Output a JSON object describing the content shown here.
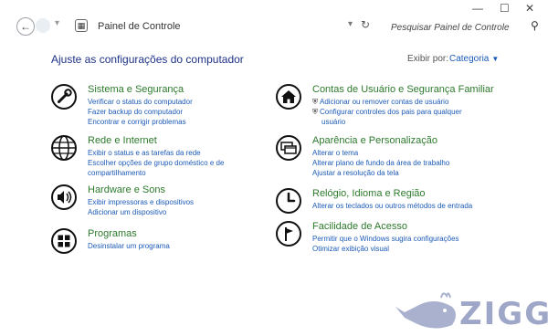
{
  "window": {
    "minimize_icon": "minimize-icon",
    "maximize_icon": "maximize-icon",
    "close_icon": "close-icon"
  },
  "nav": {
    "back_glyph": "←",
    "breadcrumb": "Painel de Controle",
    "search_placeholder": "Pesquisar Painel de Controle"
  },
  "main": {
    "page_title": "Ajuste as configurações do computador",
    "view_by_label": "Exibir por:",
    "view_by_value": "Categoria"
  },
  "categories": [
    {
      "title": "Sistema e Segurança",
      "icon": "wrench-icon",
      "links": [
        "Verificar o status do computador",
        "Fazer backup do computador",
        "Encontrar e corrigir problemas"
      ]
    },
    {
      "title": "Rede e Internet",
      "icon": "globe-icon",
      "links": [
        "Exibir o status e as tarefas da rede",
        "Escolher opções de grupo doméstico e de",
        "compartilhamento"
      ]
    },
    {
      "title": "Hardware e Sons",
      "icon": "speaker-icon",
      "links": [
        "Exibir impressoras e dispositivos",
        "Adicionar um dispositivo"
      ]
    },
    {
      "title": "Programas",
      "icon": "programs-icon",
      "links": [
        "Desinstalar um programa"
      ]
    },
    {
      "title": "Contas de Usuário e Segurança Familiar",
      "icon": "home-icon",
      "links": [
        "Adicionar ou remover contas de usuário",
        "Configurar controles dos pais para qualquer",
        "usuário"
      ]
    },
    {
      "title": "Aparência e Personalização",
      "icon": "display-icon",
      "links": [
        "Alterar o tema",
        "Alterar plano de fundo da área de trabalho",
        "Ajustar a resolução da tela"
      ]
    },
    {
      "title": "Relógio, Idioma e Região",
      "icon": "clock-icon",
      "links": [
        "Alterar os teclados ou outros métodos de entrada"
      ]
    },
    {
      "title": "Facilidade de Acesso",
      "icon": "accessibility-icon",
      "links": [
        "Permitir que o Windows sugira configurações",
        "Otimizar exibição visual"
      ]
    }
  ],
  "watermark": {
    "text": "ZIGG"
  }
}
